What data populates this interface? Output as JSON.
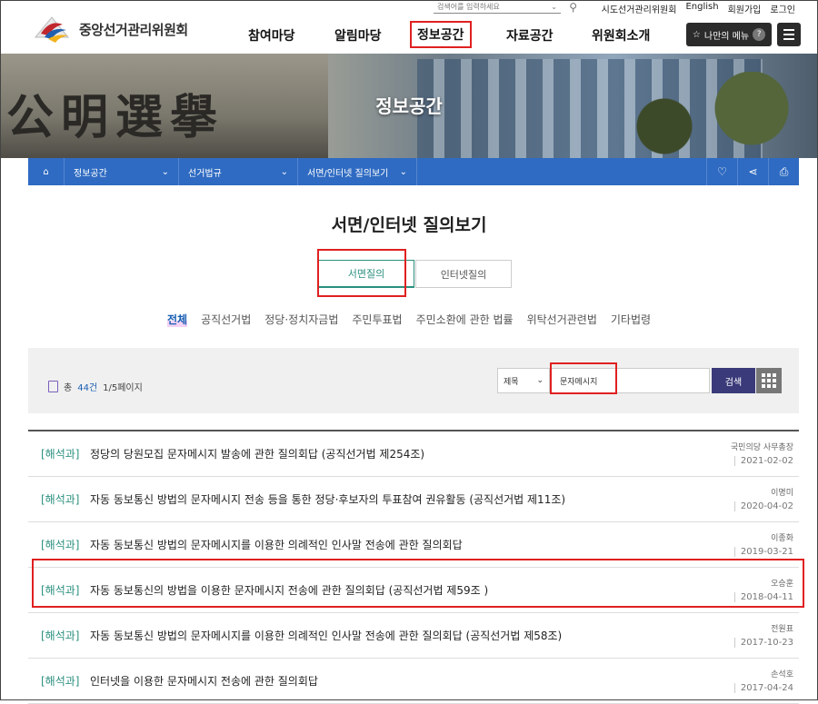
{
  "header": {
    "site_title": "중앙선거관리위원회",
    "search_placeholder": "검색어를 입력하세요",
    "top_links": [
      "시도선거관리위원회",
      "English",
      "회원가입",
      "로그인"
    ],
    "gnb": [
      "참여마당",
      "알림마당",
      "정보공간",
      "자료공간",
      "위원회소개"
    ],
    "my_menu": "나만의 메뉴"
  },
  "banner": {
    "title": "정보공간",
    "glyphs": "公明選擧"
  },
  "breadcrumb": [
    "정보공간",
    "선거법규",
    "서면/인터넷 질의보기"
  ],
  "page": {
    "title": "서면/인터넷 질의보기"
  },
  "tabs": [
    "서면질의",
    "인터넷질의"
  ],
  "categories": [
    "전체",
    "공직선거법",
    "정당·정치자금법",
    "주민투표법",
    "주민소환에 관한 법률",
    "위탁선거관련법",
    "기타법령"
  ],
  "search": {
    "count_prefix": "총",
    "count": "44건",
    "page_info": "1/5페이지",
    "select_value": "제목",
    "keyword": "문자메시지",
    "button": "검색"
  },
  "rows": [
    {
      "cat": "[해석과]",
      "title": "정당의 당원모집 문자메시지 발송에 관한 질의회답 (공직선거법 제254조)",
      "author": "국민의당 사무총장",
      "date": "2021-02-02"
    },
    {
      "cat": "[해석과]",
      "title": "자동 동보통신 방법의 문자메시지 전송 등을 통한 정당·후보자의 투표참여 권유활동 (공직선거법 제11조)",
      "author": "이명미",
      "date": "2020-04-02"
    },
    {
      "cat": "[해석과]",
      "title": "자동 동보통신 방법의 문자메시지를 이용한 의례적인 인사말 전송에 관한 질의회답",
      "author": "이종화",
      "date": "2019-03-21"
    },
    {
      "cat": "[해석과]",
      "title": "자동 동보통신의 방법을 이용한 문자메시지 전송에 관한 질의회답 (공직선거법 제59조 )",
      "author": "오승훈",
      "date": "2018-04-11"
    },
    {
      "cat": "[해석과]",
      "title": "자동 동보통신 방법의 문자메시지를 이용한 의례적인 인사말 전송에 관한 질의회답 (공직선거법 제58조)",
      "author": "전원표",
      "date": "2017-10-23"
    },
    {
      "cat": "[해석과]",
      "title": "인터넷을 이용한 문자메시지 전송에 관한 질의회답",
      "author": "손석호",
      "date": "2017-04-24"
    }
  ],
  "colors": {
    "accent": "#2f6bc2",
    "highlight": "#e02020",
    "category": "#2a8f7e"
  }
}
